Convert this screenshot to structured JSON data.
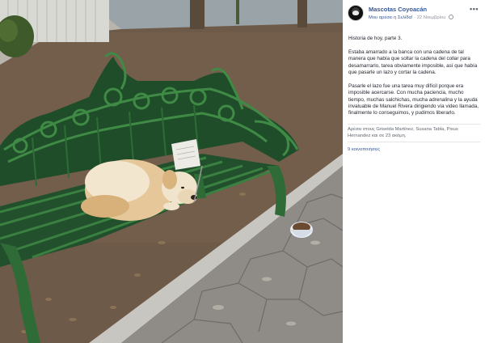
{
  "post": {
    "page_name": "Mascotas Coyoacán",
    "liked_text": "Μου αρέσει η Σελίδα!",
    "date": "22 Νοεμβρίου",
    "more_icon": "more-dots-icon",
    "globe_icon": "globe-icon",
    "paragraphs": [
      "Historia de hoy, parte 3.",
      "Estaba amarrado a la banca con una cadena de tal manera que había que soltar la cadena del collar para desamarrarlo, tarea obviamente imposible, así que había que pasarle un lazo y cortar la cadena.",
      "Pasarle el lazo fue una tarea muy difícil porque era imposible acercarse. Con mucha paciencia, mucho tiempo, muchas salchichas, mucha adrenalina y la ayuda invaluable de Manuel Rivera dirigiendo vía video llamada, finalmente lo conseguimos, y pudimos liberarlo."
    ],
    "reactions_text": "Αρέσει στους Griselda Martínez, Susana Tabla, Pisus Hernandez και σε 23 ακόμη.",
    "comments_text": "9 κοινοποιήσεις"
  },
  "photo": {
    "description_icon": "photo-dog-on-bench"
  }
}
